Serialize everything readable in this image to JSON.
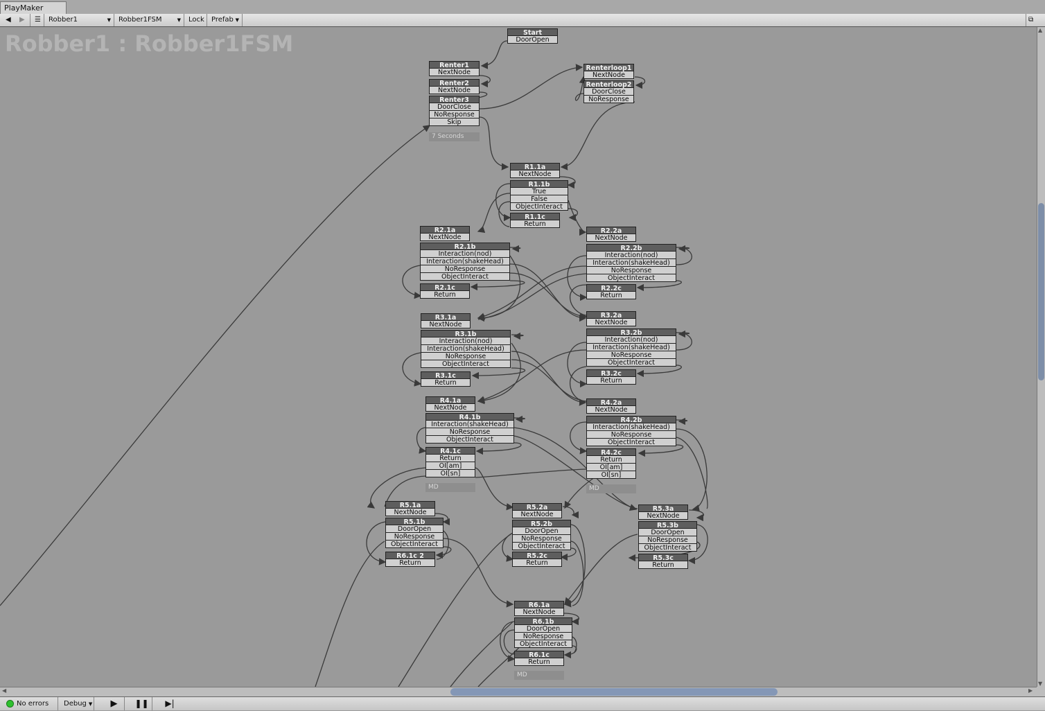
{
  "window": {
    "tab_title": "PlayMaker"
  },
  "toolbar": {
    "back": "◀",
    "forward": "▶",
    "menu": "☰",
    "gameobject": "Robber1",
    "fsm": "Robber1FSM",
    "lock": "Lock",
    "prefab": "Prefab"
  },
  "canvas": {
    "fsm_title": "Robber1 : Robber1FSM"
  },
  "states": {
    "start": {
      "title": "Start",
      "events": [
        "DoorOpen"
      ]
    },
    "renter1": {
      "title": "Renter1",
      "events": [
        "NextNode"
      ]
    },
    "renter2": {
      "title": "Renter2",
      "events": [
        "NextNode"
      ]
    },
    "renter3": {
      "title": "Renter3",
      "events": [
        "DoorClose",
        "NoResponse",
        "Skip"
      ]
    },
    "renterloop1": {
      "title": "Renterloop1",
      "events": [
        "NextNode"
      ]
    },
    "renterloop2": {
      "title": "Renterloop2",
      "events": [
        "DoorClose",
        "NoResponse"
      ]
    },
    "r11a": {
      "title": "R1.1a",
      "events": [
        "NextNode"
      ]
    },
    "r11b": {
      "title": "R1.1b",
      "events": [
        "True",
        "False",
        "ObjectInteract"
      ]
    },
    "r11c": {
      "title": "R1.1c",
      "events": [
        "Return"
      ]
    },
    "r21a": {
      "title": "R2.1a",
      "events": [
        "NextNode"
      ]
    },
    "r21b": {
      "title": "R2.1b",
      "events": [
        "Interaction(nod)",
        "Interaction(shakeHead)",
        "NoResponse",
        "ObjectInteract"
      ]
    },
    "r21c": {
      "title": "R2.1c",
      "events": [
        "Return"
      ]
    },
    "r22a": {
      "title": "R2.2a",
      "events": [
        "NextNode"
      ]
    },
    "r22b": {
      "title": "R2.2b",
      "events": [
        "Interaction(nod)",
        "Interaction(shakeHead)",
        "NoResponse",
        "ObjectInteract"
      ]
    },
    "r22c": {
      "title": "R2.2c",
      "events": [
        "Return"
      ]
    },
    "r31a": {
      "title": "R3.1a",
      "events": [
        "NextNode"
      ]
    },
    "r31b": {
      "title": "R3.1b",
      "events": [
        "Interaction(nod)",
        "Interaction(shakeHead)",
        "NoResponse",
        "ObjectInteract"
      ]
    },
    "r31c": {
      "title": "R3.1c",
      "events": [
        "Return"
      ]
    },
    "r32a": {
      "title": "R3.2a",
      "events": [
        "NextNode"
      ]
    },
    "r32b": {
      "title": "R3.2b",
      "events": [
        "Interaction(nod)",
        "Interaction(shakeHead)",
        "NoResponse",
        "ObjectInteract"
      ]
    },
    "r32c": {
      "title": "R3.2c",
      "events": [
        "Return"
      ]
    },
    "r41a": {
      "title": "R4.1a",
      "events": [
        "NextNode"
      ]
    },
    "r41b": {
      "title": "R4.1b",
      "events": [
        "Interaction(shakeHead)",
        "NoResponse",
        "ObjectInteract"
      ]
    },
    "r41c": {
      "title": "R4.1c",
      "events": [
        "Return",
        "OI[am]",
        "OI[sn]"
      ]
    },
    "r42a": {
      "title": "R4.2a",
      "events": [
        "NextNode"
      ]
    },
    "r42b": {
      "title": "R4.2b",
      "events": [
        "Interaction(shakeHead)",
        "NoResponse",
        "ObjectInteract"
      ]
    },
    "r42c": {
      "title": "R4.2c",
      "events": [
        "Return",
        "OI[am]",
        "OI[sn]"
      ]
    },
    "r51a": {
      "title": "R5.1a",
      "events": [
        "NextNode"
      ]
    },
    "r51b": {
      "title": "R5.1b",
      "events": [
        "DoorOpen",
        "NoResponse",
        "ObjectInteract"
      ]
    },
    "r61c2": {
      "title": "R6.1c 2",
      "events": [
        "Return"
      ]
    },
    "r52a": {
      "title": "R5.2a",
      "events": [
        "NextNode"
      ]
    },
    "r52b": {
      "title": "R5.2b",
      "events": [
        "DoorOpen",
        "NoResponse",
        "ObjectInteract"
      ]
    },
    "r52c": {
      "title": "R5.2c",
      "events": [
        "Return"
      ]
    },
    "r53a": {
      "title": "R5.3a",
      "events": [
        "NextNode"
      ]
    },
    "r53b": {
      "title": "R5.3b",
      "events": [
        "DoorOpen",
        "NoResponse",
        "ObjectInteract"
      ]
    },
    "r53c": {
      "title": "R5.3c",
      "events": [
        "Return"
      ]
    },
    "r61a": {
      "title": "R6.1a",
      "events": [
        "NextNode"
      ]
    },
    "r61b": {
      "title": "R6.1b",
      "events": [
        "DoorOpen",
        "NoResponse",
        "ObjectInteract"
      ]
    },
    "r61c": {
      "title": "R6.1c",
      "events": [
        "Return"
      ]
    }
  },
  "notes": {
    "renter": "7 Seconds",
    "md1": "MD",
    "md2": "MD",
    "md3": "MD"
  },
  "statusbar": {
    "errors": "No errors",
    "debug": "Debug"
  },
  "colors": {
    "canvas": "#9a9a9a",
    "state_header": "#5e5e5e",
    "event_row": "#d0d0d0",
    "link": "#3a3a3a",
    "status_ok": "#2ec02e"
  }
}
